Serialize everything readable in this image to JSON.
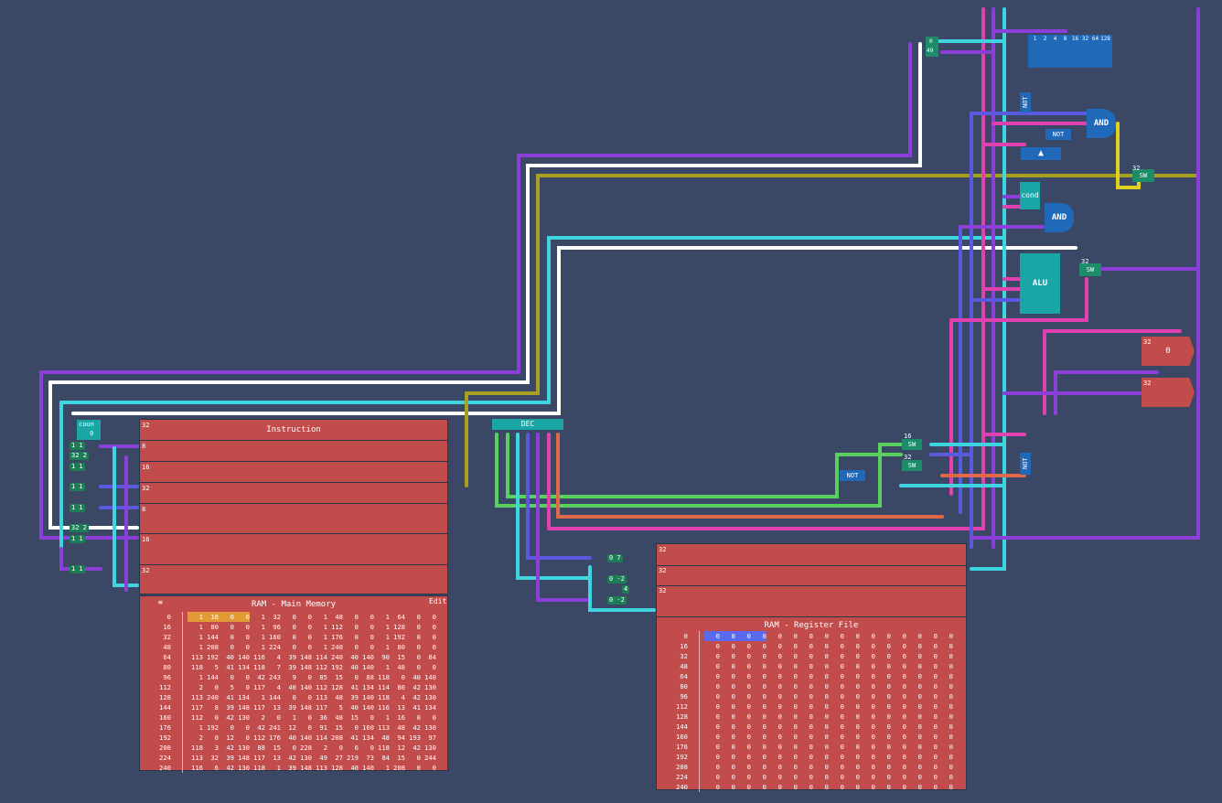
{
  "instruction": {
    "title": "Instruction",
    "counter_label": "coun",
    "counter_value": "0",
    "width_label": "32",
    "rows": [
      "8",
      "16",
      "32",
      "8",
      "16",
      "32"
    ]
  },
  "decoder": {
    "label": "DEC"
  },
  "main_memory": {
    "title": "RAM - Main Memory",
    "edit_label": "Edit",
    "addresses": [
      "0",
      "16",
      "32",
      "48",
      "64",
      "80",
      "96",
      "112",
      "128",
      "144",
      "160",
      "176",
      "192",
      "208",
      "224",
      "240"
    ],
    "rows": [
      [
        "1",
        "16",
        "0",
        "0",
        "1",
        "32",
        "0",
        "0",
        "1",
        "48",
        "0",
        "0",
        "1",
        "64",
        "0",
        "0"
      ],
      [
        "1",
        "80",
        "0",
        "0",
        "1",
        "96",
        "0",
        "0",
        "1",
        "112",
        "0",
        "0",
        "1",
        "128",
        "0",
        "0"
      ],
      [
        "1",
        "144",
        "0",
        "0",
        "1",
        "160",
        "0",
        "0",
        "1",
        "176",
        "0",
        "0",
        "1",
        "192",
        "0",
        "0"
      ],
      [
        "1",
        "208",
        "0",
        "0",
        "1",
        "224",
        "0",
        "0",
        "1",
        "240",
        "0",
        "0",
        "1",
        "80",
        "0",
        "0"
      ],
      [
        "113",
        "192",
        "40",
        "140",
        "116",
        "4",
        "39",
        "148",
        "114",
        "240",
        "40",
        "140",
        "90",
        "15",
        "0",
        "84"
      ],
      [
        "118",
        "5",
        "41",
        "134",
        "118",
        "7",
        "39",
        "148",
        "112",
        "192",
        "40",
        "140",
        "1",
        "48",
        "0",
        "0"
      ],
      [
        "1",
        "144",
        "0",
        "0",
        "42",
        "243",
        "9",
        "0",
        "85",
        "15",
        "0",
        "88",
        "118",
        "0",
        "40",
        "140"
      ],
      [
        "2",
        "0",
        "5",
        "0",
        "117",
        "4",
        "40",
        "140",
        "112",
        "128",
        "41",
        "134",
        "114",
        "80",
        "42",
        "130"
      ],
      [
        "113",
        "240",
        "41",
        "134",
        "1",
        "144",
        "0",
        "0",
        "113",
        "48",
        "39",
        "140",
        "118",
        "4",
        "42",
        "130"
      ],
      [
        "117",
        "8",
        "39",
        "148",
        "117",
        "13",
        "39",
        "148",
        "117",
        "5",
        "40",
        "140",
        "116",
        "13",
        "41",
        "134"
      ],
      [
        "112",
        "0",
        "42",
        "130",
        "2",
        "0",
        "1",
        "0",
        "36",
        "48",
        "15",
        "0",
        "1",
        "16",
        "0",
        "0"
      ],
      [
        "1",
        "192",
        "0",
        "0",
        "42",
        "241",
        "12",
        "0",
        "91",
        "15",
        "0",
        "160",
        "113",
        "48",
        "42",
        "130"
      ],
      [
        "2",
        "0",
        "12",
        "0",
        "112",
        "176",
        "40",
        "140",
        "114",
        "208",
        "41",
        "134",
        "48",
        "94",
        "193",
        "97"
      ],
      [
        "118",
        "3",
        "42",
        "130",
        "88",
        "15",
        "0",
        "228",
        "2",
        "0",
        "6",
        "0",
        "118",
        "12",
        "42",
        "130"
      ],
      [
        "113",
        "32",
        "39",
        "148",
        "117",
        "13",
        "42",
        "130",
        "49",
        "27",
        "219",
        "73",
        "84",
        "15",
        "0",
        "244"
      ],
      [
        "116",
        "6",
        "42",
        "130",
        "118",
        "1",
        "39",
        "148",
        "113",
        "128",
        "40",
        "140",
        "1",
        "208",
        "0",
        "0"
      ]
    ]
  },
  "register_file": {
    "title": "RAM - Register File",
    "addresses": [
      "0",
      "16",
      "32",
      "48",
      "64",
      "80",
      "96",
      "112",
      "128",
      "144",
      "160",
      "176",
      "192",
      "208",
      "224",
      "240"
    ],
    "rows": [
      [
        "0",
        "0",
        "0",
        "0",
        "0",
        "0",
        "0",
        "0",
        "0",
        "0",
        "0",
        "0",
        "0",
        "0",
        "0",
        "0"
      ],
      [
        "0",
        "0",
        "0",
        "0",
        "0",
        "0",
        "0",
        "0",
        "0",
        "0",
        "0",
        "0",
        "0",
        "0",
        "0",
        "0"
      ],
      [
        "0",
        "0",
        "0",
        "0",
        "0",
        "0",
        "0",
        "0",
        "0",
        "0",
        "0",
        "0",
        "0",
        "0",
        "0",
        "0"
      ],
      [
        "0",
        "0",
        "0",
        "0",
        "0",
        "0",
        "0",
        "0",
        "0",
        "0",
        "0",
        "0",
        "0",
        "0",
        "0",
        "0"
      ],
      [
        "0",
        "0",
        "0",
        "0",
        "0",
        "0",
        "0",
        "0",
        "0",
        "0",
        "0",
        "0",
        "0",
        "0",
        "0",
        "0"
      ],
      [
        "0",
        "0",
        "0",
        "0",
        "0",
        "0",
        "0",
        "0",
        "0",
        "0",
        "0",
        "0",
        "0",
        "0",
        "0",
        "0"
      ],
      [
        "0",
        "0",
        "0",
        "0",
        "0",
        "0",
        "0",
        "0",
        "0",
        "0",
        "0",
        "0",
        "0",
        "0",
        "0",
        "0"
      ],
      [
        "0",
        "0",
        "0",
        "0",
        "0",
        "0",
        "0",
        "0",
        "0",
        "0",
        "0",
        "0",
        "0",
        "0",
        "0",
        "0"
      ],
      [
        "0",
        "0",
        "0",
        "0",
        "0",
        "0",
        "0",
        "0",
        "0",
        "0",
        "0",
        "0",
        "0",
        "0",
        "0",
        "0"
      ],
      [
        "0",
        "0",
        "0",
        "0",
        "0",
        "0",
        "0",
        "0",
        "0",
        "0",
        "0",
        "0",
        "0",
        "0",
        "0",
        "0"
      ],
      [
        "0",
        "0",
        "0",
        "0",
        "0",
        "0",
        "0",
        "0",
        "0",
        "0",
        "0",
        "0",
        "0",
        "0",
        "0",
        "0"
      ],
      [
        "0",
        "0",
        "0",
        "0",
        "0",
        "0",
        "0",
        "0",
        "0",
        "0",
        "0",
        "0",
        "0",
        "0",
        "0",
        "0"
      ],
      [
        "0",
        "0",
        "0",
        "0",
        "0",
        "0",
        "0",
        "0",
        "0",
        "0",
        "0",
        "0",
        "0",
        "0",
        "0",
        "0"
      ],
      [
        "0",
        "0",
        "0",
        "0",
        "0",
        "0",
        "0",
        "0",
        "0",
        "0",
        "0",
        "0",
        "0",
        "0",
        "0",
        "0"
      ],
      [
        "0",
        "0",
        "0",
        "0",
        "0",
        "0",
        "0",
        "0",
        "0",
        "0",
        "0",
        "0",
        "0",
        "0",
        "0",
        "0"
      ],
      [
        "0",
        "0",
        "0",
        "0",
        "0",
        "0",
        "0",
        "0",
        "0",
        "0",
        "0",
        "0",
        "0",
        "0",
        "0",
        "0"
      ]
    ],
    "port_labels": [
      "32",
      "32",
      "32"
    ]
  },
  "logic": {
    "and_label": "AND",
    "not_label": "NOT",
    "alu_label": "ALU",
    "cond_label": "cond",
    "sw_label": "SW",
    "width_32": "32",
    "width_16": "16",
    "bit_labels": [
      "1",
      "2",
      "4",
      "8",
      "16",
      "32",
      "64",
      "128"
    ],
    "out1_value": "0",
    "counter_small_top": "0",
    "counter_small_bottom": "49"
  },
  "splitters": {
    "left_tags": [
      "1 1",
      "32 2",
      "1 1",
      "1 1",
      "1 1",
      "32 2",
      "1 1",
      "1 1"
    ],
    "reg_tags": [
      "0 7",
      "0 -2",
      "4",
      "0 -2"
    ]
  },
  "colors": {
    "background": "#3a4866",
    "panel": "#c24b4b",
    "purple": "#8c3fd8",
    "white": "#ffffff",
    "cyan": "#3ed4e0",
    "olive": "#a8a020",
    "magenta": "#e040b0",
    "blue": "#5a5ae0",
    "green": "#5ad060",
    "orange": "#e06848",
    "yellow": "#e0d020",
    "gate": "#2068b8"
  }
}
